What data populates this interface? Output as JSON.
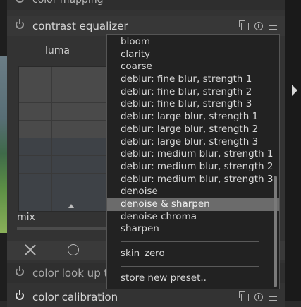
{
  "modules": {
    "top": {
      "title": "color mapping"
    },
    "contrast_equalizer": {
      "title": "contrast equalizer",
      "tab": "luma",
      "mix_label": "mix"
    },
    "lut": {
      "title": "color look up t"
    },
    "calibration": {
      "title": "color calibration"
    }
  },
  "preset_menu": {
    "items": [
      "bloom",
      "clarity",
      "coarse",
      "deblur: fine blur, strength 1",
      "deblur: fine blur, strength 2",
      "deblur: fine blur, strength 3",
      "deblur: large blur, strength 1",
      "deblur: large blur, strength 2",
      "deblur: large blur, strength 3",
      "deblur: medium blur, strength 1",
      "deblur: medium blur, strength 2",
      "deblur: medium blur, strength 3",
      "denoise",
      "denoise & sharpen",
      "denoise chroma",
      "sharpen"
    ],
    "selected_index": 13,
    "extra": "skin_zero",
    "store": "store new preset.."
  },
  "colors": {
    "selected_bg": "#6b6b6b",
    "menu_bg": "#222222",
    "panel_bg": "#333333"
  }
}
